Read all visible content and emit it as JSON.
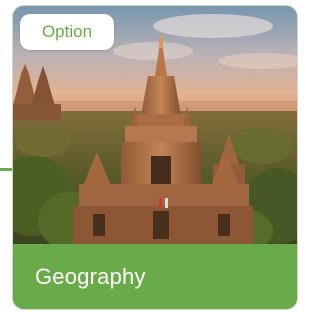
{
  "card": {
    "badge_label": "Option",
    "title": "Geography",
    "image_icon": "temple-landscape-photo"
  },
  "colors": {
    "accent": "#6aaa4a",
    "badge_bg": "#ffffff",
    "footer_text": "#ffffff"
  }
}
